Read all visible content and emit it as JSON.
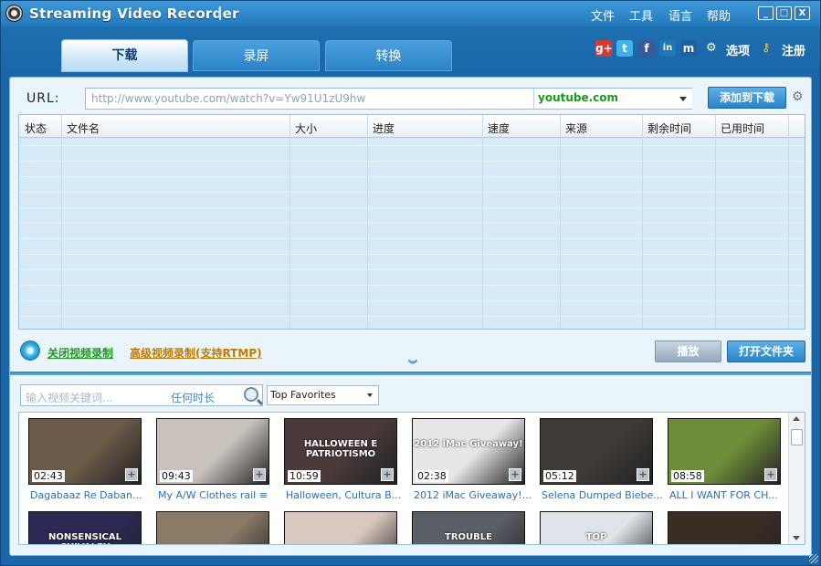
{
  "app": {
    "title": "Streaming Video Recorder"
  },
  "menu": [
    "文件",
    "工具",
    "语言",
    "帮助"
  ],
  "window_buttons": [
    "_",
    "□",
    "X"
  ],
  "tabs": [
    "下载",
    "录屏",
    "转换"
  ],
  "social": [
    {
      "name": "google-plus",
      "glyph": "g+",
      "color": "#d23b2e"
    },
    {
      "name": "twitter",
      "glyph": "t",
      "color": "#3fb3e8"
    },
    {
      "name": "facebook",
      "glyph": "f",
      "color": "#3b5998"
    },
    {
      "name": "linkedin",
      "glyph": "in",
      "color": "#1c79b5"
    },
    {
      "name": "myspace",
      "glyph": "m",
      "color": "#1f5fa6"
    }
  ],
  "top_links": {
    "options": "选项",
    "register": "注册"
  },
  "url": {
    "label": "URL:",
    "value": "http://www.youtube.com/watch?v=Yw91U1zU9hw",
    "site": "youtube.com",
    "add_button": "添加到下载"
  },
  "columns": [
    "状态",
    "文件名",
    "大小",
    "进度",
    "速度",
    "来源",
    "剩余时间",
    "已用时间"
  ],
  "recording": {
    "close": "关闭视频录制",
    "advanced": "高级视频录制(支持RTMP)"
  },
  "buttons": {
    "play": "播放",
    "open_folder": "打开文件夹"
  },
  "search": {
    "placeholder": "输入视频关键词...",
    "duration": "任何时长",
    "category": "Top Favorites"
  },
  "videos": [
    {
      "duration": "02:43",
      "title": "Dagabaaz Re Daban...",
      "thumb": "#6b5a48"
    },
    {
      "duration": "09:43",
      "title": "My A/W Clothes rail ≡",
      "thumb": "#c9c2bc"
    },
    {
      "duration": "10:59",
      "title": "Halloween, Cultura B...",
      "thumb": "#4a3a3a",
      "caption": "HALLOWEEN E PATRIOTISMO"
    },
    {
      "duration": "02:38",
      "title": "2012 iMac Giveaway!...",
      "thumb": "#e6e6e6",
      "caption": "2012 iMac Giveaway!"
    },
    {
      "duration": "05:12",
      "title": "Selena Dumped Biebe...",
      "thumb": "#3e3a36"
    },
    {
      "duration": "08:58",
      "title": "ALL I WANT FOR CH...",
      "thumb": "#6f8c3a"
    },
    {
      "duration": "",
      "title": "",
      "thumb": "#2c2a55",
      "caption": "NONSENSICAL CHIVALRY"
    },
    {
      "duration": "",
      "title": "",
      "thumb": "#8a7a66"
    },
    {
      "duration": "",
      "title": "",
      "thumb": "#d8c8c0"
    },
    {
      "duration": "",
      "title": "",
      "thumb": "#5a5e66",
      "caption": "TROUBLE"
    },
    {
      "duration": "",
      "title": "",
      "thumb": "#dfe4ea",
      "caption": "TOP"
    },
    {
      "duration": "",
      "title": "",
      "thumb": "#3a2d26"
    }
  ]
}
